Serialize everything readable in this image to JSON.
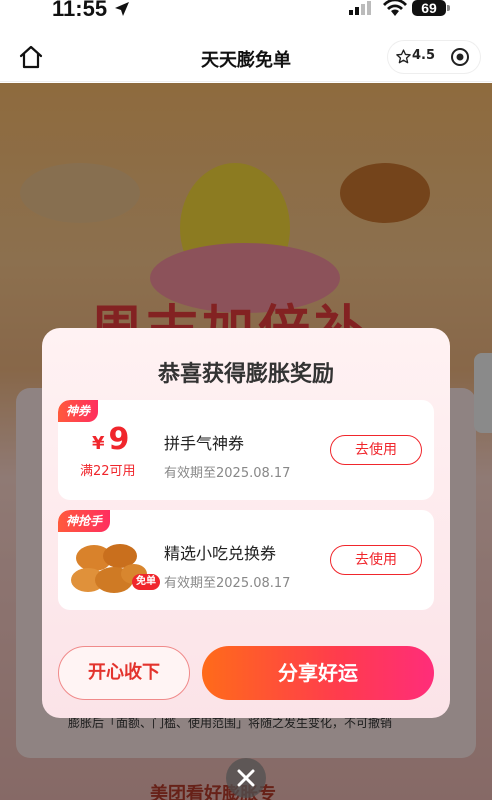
{
  "status_bar": {
    "time": "11:55",
    "battery": "69"
  },
  "nav": {
    "title": "天天膨免单",
    "rating": "4.5"
  },
  "background": {
    "banner": "周末加倍补",
    "footer_note": "膨胀后「面额、门槛、使用范围」将随之发生变化，不可撤销",
    "bottom_title": "美团看好膨胀专"
  },
  "modal": {
    "title": "恭喜获得膨胀奖励",
    "coupons": [
      {
        "tag": "神券",
        "currency": "¥",
        "amount": "9",
        "threshold": "满22可用",
        "name": "拼手气神券",
        "expiry": "有效期至2025.08.17",
        "action": "去使用"
      },
      {
        "tag": "神抢手",
        "badge": "免单",
        "name": "精选小吃兑换券",
        "expiry": "有效期至2025.08.17",
        "action": "去使用"
      }
    ],
    "accept_label": "开心收下",
    "share_label": "分享好运"
  },
  "colors": {
    "accent_red": "#f0262c",
    "share_gradient_start": "#ff6b1a",
    "share_gradient_end": "#ff2d7a"
  },
  "icons": {
    "home": "home-icon",
    "star": "star-icon",
    "record": "record-icon",
    "close": "close-icon"
  }
}
